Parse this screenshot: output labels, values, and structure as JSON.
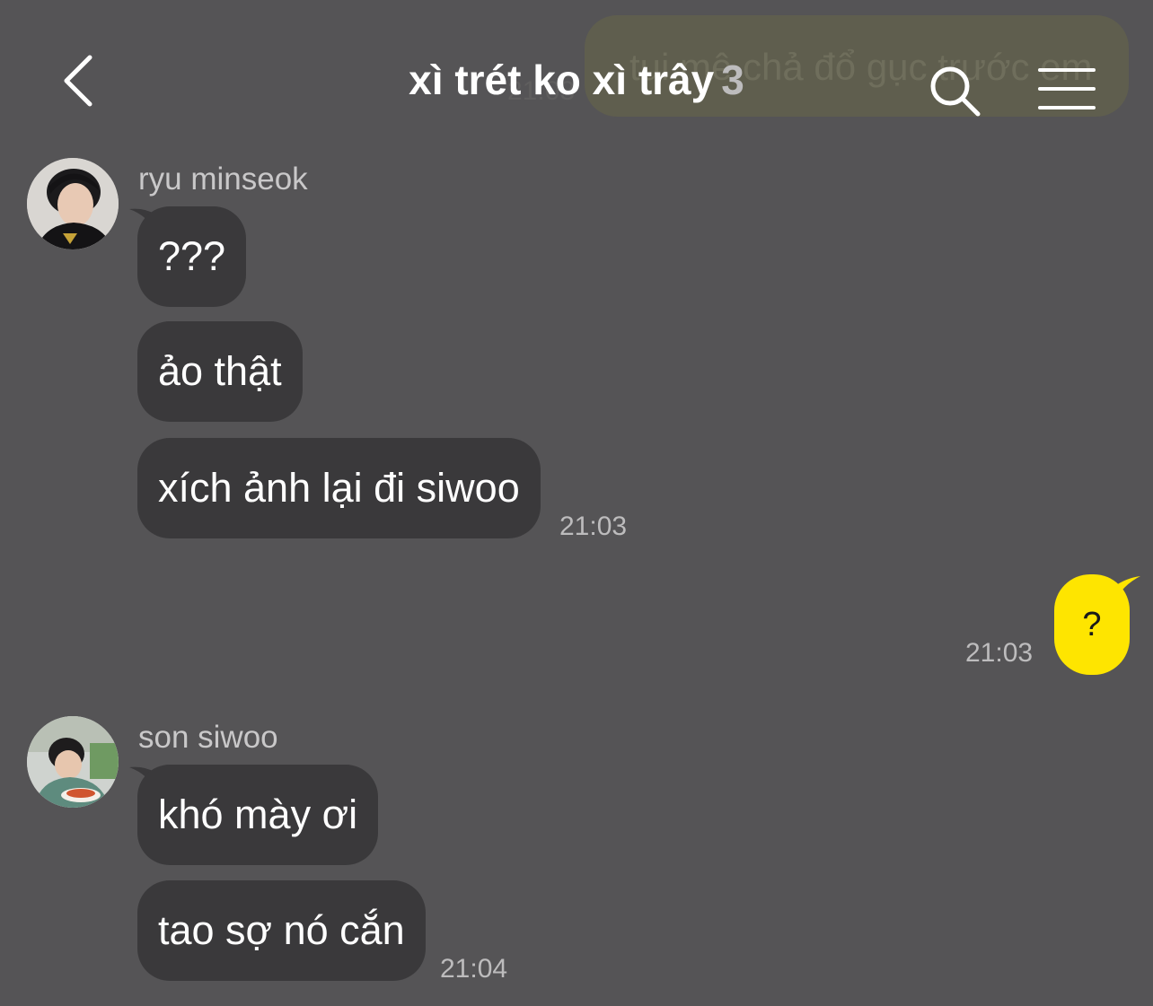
{
  "background_message": {
    "text": "tui mê chả đổ gục trước em",
    "time": "21:03"
  },
  "header": {
    "title": "xì trét ko xì trây",
    "member_count": "3",
    "back_icon": "chevron-left-icon",
    "search_icon": "search-icon",
    "menu_icon": "hamburger-menu-icon"
  },
  "groups": [
    {
      "sender": "ryu minseok",
      "messages": [
        "???",
        "ảo thật",
        "xích ảnh lại đi siwoo"
      ],
      "time": "21:03"
    },
    {
      "sender": "son siwoo",
      "messages": [
        "khó mày ơi",
        "tao sợ nó cắn"
      ],
      "time": "21:04"
    }
  ],
  "my_message": {
    "text": "?",
    "time": "21:03"
  },
  "colors": {
    "background": "#555456",
    "incoming_bubble": "#3a393b",
    "outgoing_bubble": "#fee500"
  }
}
